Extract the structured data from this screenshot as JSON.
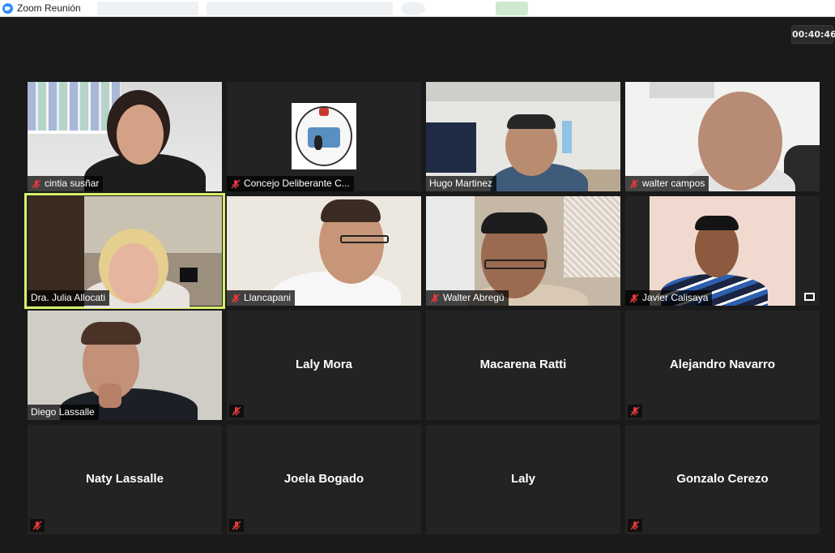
{
  "window": {
    "title": "Zoom Reunión"
  },
  "timer": "00:40:46",
  "participants": [
    {
      "name": "cintia susñar",
      "video": true,
      "muted": true
    },
    {
      "name": "Concejo Deliberante C...",
      "video": true,
      "muted": true
    },
    {
      "name": "Hugo Martinez",
      "video": true,
      "muted": false
    },
    {
      "name": "walter campos",
      "video": true,
      "muted": true
    },
    {
      "name": "Dra. Julia Allocati",
      "video": true,
      "muted": false,
      "active_speaker": true
    },
    {
      "name": "Llancapani",
      "video": true,
      "muted": true
    },
    {
      "name": "Walter Abregú",
      "video": true,
      "muted": true
    },
    {
      "name": "Javier Calisaya",
      "video": true,
      "muted": true
    },
    {
      "name": "Diego Lassalle",
      "video": true,
      "muted": false
    },
    {
      "name": "Laly Mora",
      "video": false,
      "muted": true
    },
    {
      "name": "Macarena Ratti",
      "video": false,
      "muted": false
    },
    {
      "name": "Alejandro Navarro",
      "video": false,
      "muted": true
    },
    {
      "name": "Naty Lassalle",
      "video": false,
      "muted": true
    },
    {
      "name": "Joela Bogado",
      "video": false,
      "muted": true
    },
    {
      "name": "Laly",
      "video": false,
      "muted": false
    },
    {
      "name": "Gonzalo Cerezo",
      "video": false,
      "muted": true
    }
  ],
  "colors": {
    "active_border": "#d6f06a",
    "mute_red": "#e0393e",
    "background": "#1a1a1a"
  }
}
